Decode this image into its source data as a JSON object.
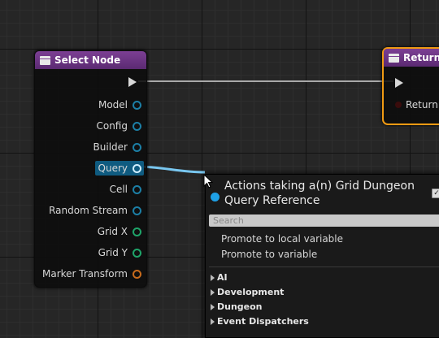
{
  "select_node": {
    "title": "Select Node",
    "pins": [
      {
        "label": "Model",
        "color": "#1c7fa6"
      },
      {
        "label": "Config",
        "color": "#1c7fa6"
      },
      {
        "label": "Builder",
        "color": "#1c7fa6"
      },
      {
        "label": "Query",
        "color": "#cfefff",
        "selected": true
      },
      {
        "label": "Cell",
        "color": "#1c7fa6"
      },
      {
        "label": "Random Stream",
        "color": "#1c7fa6"
      },
      {
        "label": "Grid X",
        "color": "#1fa56a"
      },
      {
        "label": "Grid Y",
        "color": "#1fa56a"
      },
      {
        "label": "Marker Transform",
        "color": "#c86b1c"
      }
    ]
  },
  "return_node": {
    "title": "Return",
    "pin_label": "Return"
  },
  "context_menu": {
    "title": "Actions taking a(n) Grid Dungeon Query Reference",
    "search_placeholder": "Search",
    "items": [
      "Promote to local variable",
      "Promote to variable"
    ],
    "categories": [
      "AI",
      "Development",
      "Dungeon",
      "Event Dispatchers"
    ]
  },
  "colors": {
    "node_header": "#6a3584",
    "selection_outline": "#f09a13",
    "object_pin": "#1c7fa6",
    "int_pin": "#1fa56a",
    "transform_pin": "#c86b1c",
    "info_icon": "#1ea0e6"
  }
}
